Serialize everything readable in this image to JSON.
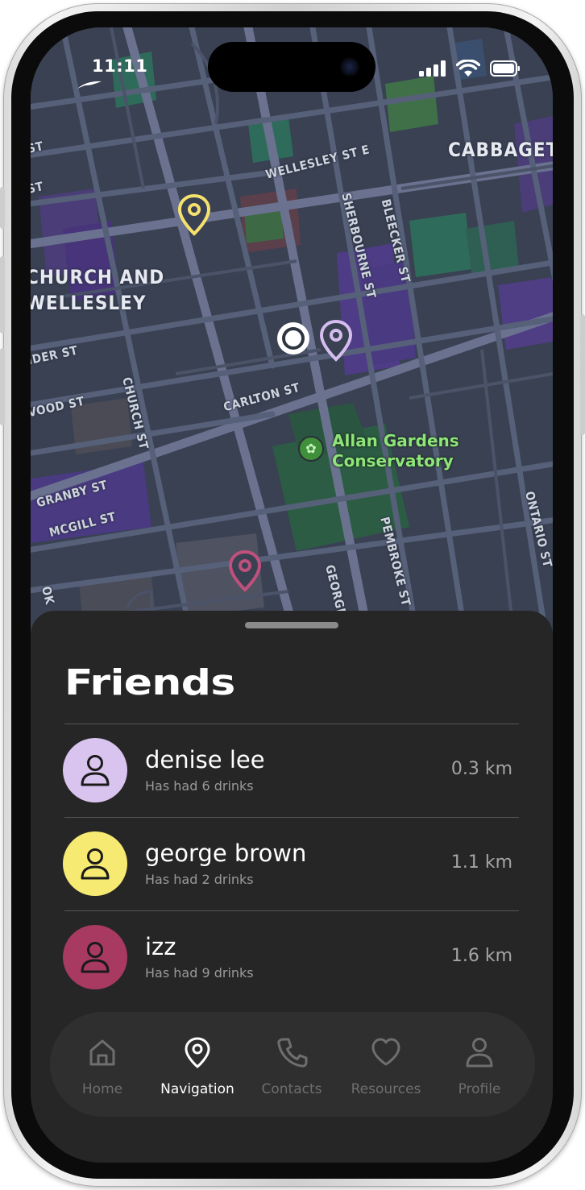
{
  "status_bar": {
    "time": "11:11",
    "icons": [
      "cellular-signal-icon",
      "wifi-icon",
      "battery-icon"
    ]
  },
  "map": {
    "district_labels": [
      "CHURCH AND",
      "WELLESLEY",
      "CABBAGET"
    ],
    "streets": [
      "WELLESLEY ST E",
      "SHERBOURNE ST",
      "BLEECKER ST",
      "CARLTON ST",
      "CHURCH ST",
      "GRANBY ST",
      "MCGILL ST",
      "PEMBROKE ST",
      "GEORGE",
      "ONTARIO ST",
      "IDER ST",
      "VOOD ST",
      "ST",
      "ST",
      "OK"
    ],
    "poi": {
      "name_line1": "Allan Gardens",
      "name_line2": "Conservatory",
      "icon": "flower-icon"
    },
    "pins": [
      {
        "color": "#f5e26e",
        "for": "george brown"
      },
      {
        "color": "#d5bdf0",
        "for": "denise lee"
      },
      {
        "color": "#c0507c",
        "for": "izz"
      }
    ]
  },
  "sheet": {
    "title": "Friends",
    "friends": [
      {
        "name": "denise lee",
        "status": "Has had 6 drinks",
        "distance": "0.3 km",
        "color": "#d9c4ef"
      },
      {
        "name": "george brown",
        "status": "Has had 2 drinks",
        "distance": "1.1 km",
        "color": "#f7ea72"
      },
      {
        "name": "izz",
        "status": "Has had 9 drinks",
        "distance": "1.6 km",
        "color": "#a83a62"
      }
    ]
  },
  "tabbar": {
    "tabs": [
      {
        "label": "Home",
        "icon": "home-icon",
        "active": false
      },
      {
        "label": "Navigation",
        "icon": "map-pin-icon",
        "active": true
      },
      {
        "label": "Contacts",
        "icon": "phone-icon",
        "active": false
      },
      {
        "label": "Resources",
        "icon": "heart-icon",
        "active": false
      },
      {
        "label": "Profile",
        "icon": "person-icon",
        "active": false
      }
    ]
  }
}
